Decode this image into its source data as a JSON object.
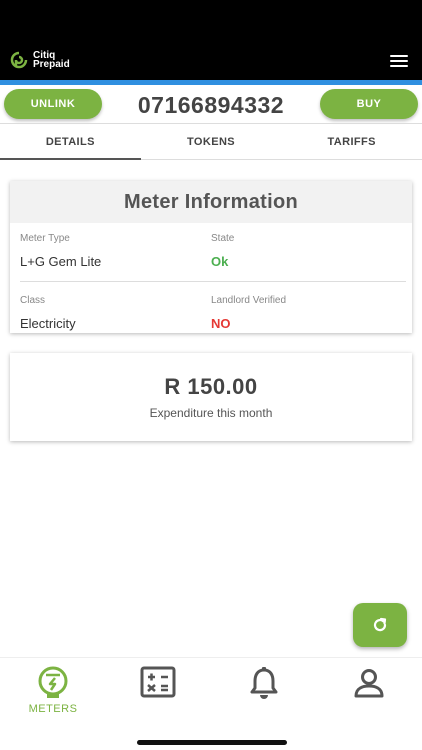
{
  "app": {
    "logo_line1": "Citiq",
    "logo_line2": "Prepaid"
  },
  "header": {
    "unlink_label": "UNLINK",
    "meter_number": "07166894332",
    "buy_label": "BUY"
  },
  "tabs": [
    {
      "label": "DETAILS",
      "active": true
    },
    {
      "label": "TOKENS",
      "active": false
    },
    {
      "label": "TARIFFS",
      "active": false
    }
  ],
  "meter_info": {
    "title": "Meter Information",
    "meter_type_label": "Meter Type",
    "meter_type_value": "L+G Gem Lite",
    "state_label": "State",
    "state_value": "Ok",
    "class_label": "Class",
    "class_value": "Electricity",
    "landlord_label": "Landlord Verified",
    "landlord_value": "NO"
  },
  "expenditure": {
    "amount": "R 150.00",
    "label": "Expenditure this month"
  },
  "bottom_nav": {
    "meters_label": "METERS",
    "icons": [
      "meter-icon",
      "calculator-icon",
      "bell-icon",
      "profile-icon"
    ]
  },
  "colors": {
    "brand_green": "#7cb342",
    "accent_blue": "#2f8fe0",
    "ok_green": "#4caf50",
    "no_red": "#e53935"
  }
}
